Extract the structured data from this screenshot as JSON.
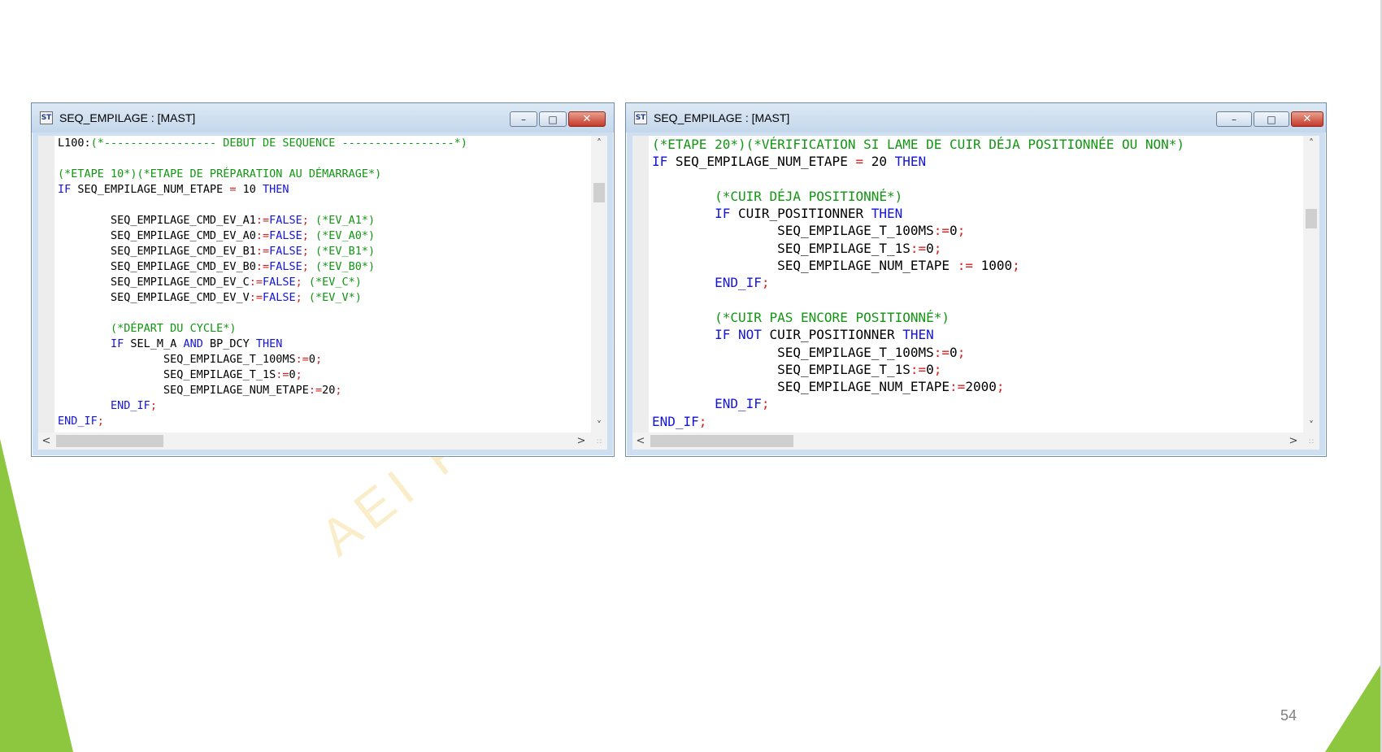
{
  "slide": {
    "number": "54",
    "watermark": "AEI   FORMA"
  },
  "windows": [
    {
      "title": "SEQ_EMPILAGE : [MAST]",
      "icon": "st-file-icon",
      "buttons": {
        "minimize": "–",
        "maximize": "□",
        "close": "✕"
      },
      "lines": [
        [
          {
            "t": "L100:"
          },
          {
            "t": "(*----------------- DEBUT DE SEQUENCE -----------------*)",
            "c": "cm"
          }
        ],
        [],
        [
          {
            "t": "(*ETAPE 10*)(*ETAPE DE PRÉPARATION AU DÉMARRAGE*)",
            "c": "cm"
          }
        ],
        [
          {
            "t": "IF",
            "c": "kw"
          },
          {
            "t": " SEQ_EMPILAGE_NUM_ETAPE "
          },
          {
            "t": "=",
            "c": "op"
          },
          {
            "t": " 10 "
          },
          {
            "t": "THEN",
            "c": "kw"
          }
        ],
        [],
        [
          {
            "t": "        SEQ_EMPILAGE_CMD_EV_A1"
          },
          {
            "t": ":=",
            "c": "op"
          },
          {
            "t": "FALSE",
            "c": "kw"
          },
          {
            "t": ";",
            "c": "op"
          },
          {
            "t": " "
          },
          {
            "t": "(*EV_A1*)",
            "c": "cm"
          }
        ],
        [
          {
            "t": "        SEQ_EMPILAGE_CMD_EV_A0"
          },
          {
            "t": ":=",
            "c": "op"
          },
          {
            "t": "FALSE",
            "c": "kw"
          },
          {
            "t": ";",
            "c": "op"
          },
          {
            "t": " "
          },
          {
            "t": "(*EV_A0*)",
            "c": "cm"
          }
        ],
        [
          {
            "t": "        SEQ_EMPILAGE_CMD_EV_B1"
          },
          {
            "t": ":=",
            "c": "op"
          },
          {
            "t": "FALSE",
            "c": "kw"
          },
          {
            "t": ";",
            "c": "op"
          },
          {
            "t": " "
          },
          {
            "t": "(*EV_B1*)",
            "c": "cm"
          }
        ],
        [
          {
            "t": "        SEQ_EMPILAGE_CMD_EV_B0"
          },
          {
            "t": ":=",
            "c": "op"
          },
          {
            "t": "FALSE",
            "c": "kw"
          },
          {
            "t": ";",
            "c": "op"
          },
          {
            "t": " "
          },
          {
            "t": "(*EV_B0*)",
            "c": "cm"
          }
        ],
        [
          {
            "t": "        SEQ_EMPILAGE_CMD_EV_C"
          },
          {
            "t": ":=",
            "c": "op"
          },
          {
            "t": "FALSE",
            "c": "kw"
          },
          {
            "t": ";",
            "c": "op"
          },
          {
            "t": " "
          },
          {
            "t": "(*EV_C*)",
            "c": "cm"
          }
        ],
        [
          {
            "t": "        SEQ_EMPILAGE_CMD_EV_V"
          },
          {
            "t": ":=",
            "c": "op"
          },
          {
            "t": "FALSE",
            "c": "kw"
          },
          {
            "t": ";",
            "c": "op"
          },
          {
            "t": " "
          },
          {
            "t": "(*EV_V*)",
            "c": "cm"
          }
        ],
        [],
        [
          {
            "t": "        "
          },
          {
            "t": "(*DÉPART DU CYCLE*)",
            "c": "cm"
          }
        ],
        [
          {
            "t": "        "
          },
          {
            "t": "IF",
            "c": "kw"
          },
          {
            "t": " SEL_M_A "
          },
          {
            "t": "AND",
            "c": "kw"
          },
          {
            "t": " BP_DCY "
          },
          {
            "t": "THEN",
            "c": "kw"
          }
        ],
        [
          {
            "t": "                SEQ_EMPILAGE_T_100MS"
          },
          {
            "t": ":=",
            "c": "op"
          },
          {
            "t": "0"
          },
          {
            "t": ";",
            "c": "op"
          }
        ],
        [
          {
            "t": "                SEQ_EMPILAGE_T_1S"
          },
          {
            "t": ":=",
            "c": "op"
          },
          {
            "t": "0"
          },
          {
            "t": ";",
            "c": "op"
          }
        ],
        [
          {
            "t": "                SEQ_EMPILAGE_NUM_ETAPE"
          },
          {
            "t": ":=",
            "c": "op"
          },
          {
            "t": "20"
          },
          {
            "t": ";",
            "c": "op"
          }
        ],
        [
          {
            "t": "        "
          },
          {
            "t": "END_IF",
            "c": "kw"
          },
          {
            "t": ";",
            "c": "op"
          }
        ],
        [
          {
            "t": "END_IF",
            "c": "kw"
          },
          {
            "t": ";",
            "c": "op"
          }
        ]
      ]
    },
    {
      "title": "SEQ_EMPILAGE : [MAST]",
      "icon": "st-file-icon",
      "buttons": {
        "minimize": "–",
        "maximize": "□",
        "close": "✕"
      },
      "lines": [
        [
          {
            "t": "(*ETAPE 20*)(*VÉRIFICATION SI LAME DE CUIR DÉJA POSITIONNÉE OU NON*)",
            "c": "cm"
          }
        ],
        [
          {
            "t": "IF",
            "c": "kw"
          },
          {
            "t": " SEQ_EMPILAGE_NUM_ETAPE "
          },
          {
            "t": "=",
            "c": "op"
          },
          {
            "t": " 20 "
          },
          {
            "t": "THEN",
            "c": "kw"
          }
        ],
        [],
        [
          {
            "t": "        "
          },
          {
            "t": "(*CUIR DÉJA POSITIONNÉ*)",
            "c": "cm"
          }
        ],
        [
          {
            "t": "        "
          },
          {
            "t": "IF",
            "c": "kw"
          },
          {
            "t": " CUIR_POSITIONNER "
          },
          {
            "t": "THEN",
            "c": "kw"
          }
        ],
        [
          {
            "t": "                SEQ_EMPILAGE_T_100MS"
          },
          {
            "t": ":=",
            "c": "op"
          },
          {
            "t": "0"
          },
          {
            "t": ";",
            "c": "op"
          }
        ],
        [
          {
            "t": "                SEQ_EMPILAGE_T_1S"
          },
          {
            "t": ":=",
            "c": "op"
          },
          {
            "t": "0"
          },
          {
            "t": ";",
            "c": "op"
          }
        ],
        [
          {
            "t": "                SEQ_EMPILAGE_NUM_ETAPE "
          },
          {
            "t": ":=",
            "c": "op"
          },
          {
            "t": " 1000"
          },
          {
            "t": ";",
            "c": "op"
          }
        ],
        [
          {
            "t": "        "
          },
          {
            "t": "END_IF",
            "c": "kw"
          },
          {
            "t": ";",
            "c": "op"
          }
        ],
        [],
        [
          {
            "t": "        "
          },
          {
            "t": "(*CUIR PAS ENCORE POSITIONNÉ*)",
            "c": "cm"
          }
        ],
        [
          {
            "t": "        "
          },
          {
            "t": "IF",
            "c": "kw"
          },
          {
            "t": " "
          },
          {
            "t": "NOT",
            "c": "kw"
          },
          {
            "t": " CUIR_POSITIONNER "
          },
          {
            "t": "THEN",
            "c": "kw"
          }
        ],
        [
          {
            "t": "                SEQ_EMPILAGE_T_100MS"
          },
          {
            "t": ":=",
            "c": "op"
          },
          {
            "t": "0"
          },
          {
            "t": ";",
            "c": "op"
          }
        ],
        [
          {
            "t": "                SEQ_EMPILAGE_T_1S"
          },
          {
            "t": ":=",
            "c": "op"
          },
          {
            "t": "0"
          },
          {
            "t": ";",
            "c": "op"
          }
        ],
        [
          {
            "t": "                SEQ_EMPILAGE_NUM_ETAPE"
          },
          {
            "t": ":=",
            "c": "op"
          },
          {
            "t": "2000"
          },
          {
            "t": ";",
            "c": "op"
          }
        ],
        [
          {
            "t": "        "
          },
          {
            "t": "END_IF",
            "c": "kw"
          },
          {
            "t": ";",
            "c": "op"
          }
        ],
        [
          {
            "t": "END_IF",
            "c": "kw"
          },
          {
            "t": ";",
            "c": "op"
          }
        ]
      ]
    }
  ],
  "scrollbars": {
    "up": "˄",
    "down": "˅",
    "left": "<",
    "right": ">",
    "grip": "∷"
  },
  "colors": {
    "keyword": "#1515d8",
    "comment": "#129612",
    "operator": "#d81f1f",
    "accent": "#8dc63f"
  }
}
